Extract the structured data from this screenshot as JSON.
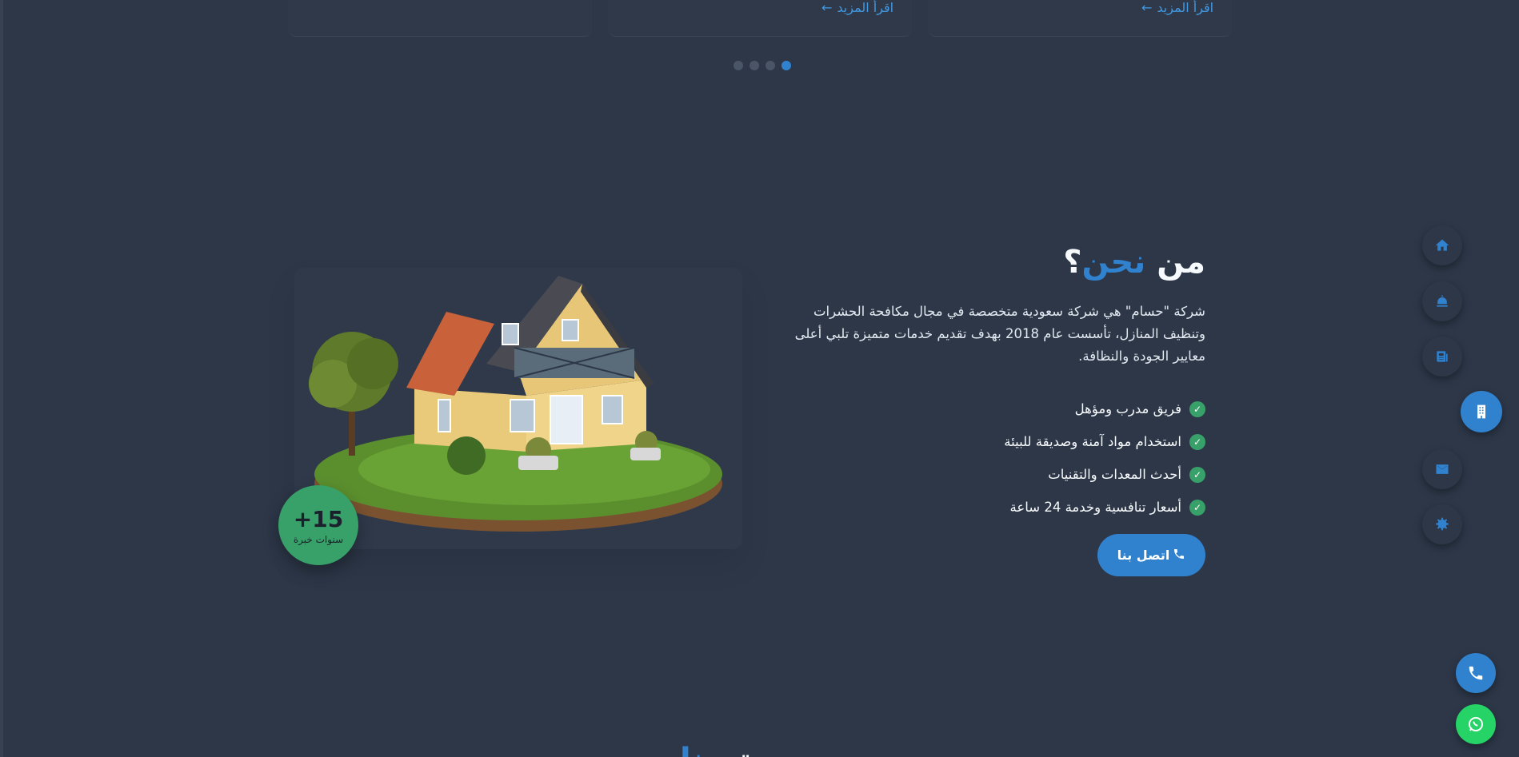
{
  "read_more": {
    "label": "اقرأ المزيد"
  },
  "carousel": {
    "dot_count": 4,
    "active_index": 3
  },
  "about": {
    "title_part1": "من ",
    "title_accent": "نحن",
    "title_suffix": "؟",
    "description": "شركة \"حسام\" هي شركة سعودية متخصصة في مجال مكافحة الحشرات وتنظيف المنازل، تأسست عام 2018 بهدف تقديم خدمات متميزة تلبي أعلى معايير الجودة والنظافة.",
    "features": [
      "فريق مدرب ومؤهل",
      "استخدام مواد آمنة وصديقة للبيئة",
      "أحدث المعدات والتقنيات",
      "أسعار تنافسية وخدمة 24 ساعة"
    ],
    "contact_button": "اتصل بنا",
    "experience_number": "+15",
    "experience_label": "سنوات خبرة"
  },
  "side_nav": {
    "items": [
      "home-icon",
      "bell-icon",
      "news-icon",
      "building-icon",
      "envelope-icon",
      "gear-icon"
    ],
    "active_index": 3
  },
  "next_section": {
    "title_visible": "تـ",
    "title_accent_visible": "بنا"
  },
  "colors": {
    "background": "#2d3748",
    "accent": "#3182ce",
    "success": "#38a169",
    "whatsapp": "#25d366"
  }
}
